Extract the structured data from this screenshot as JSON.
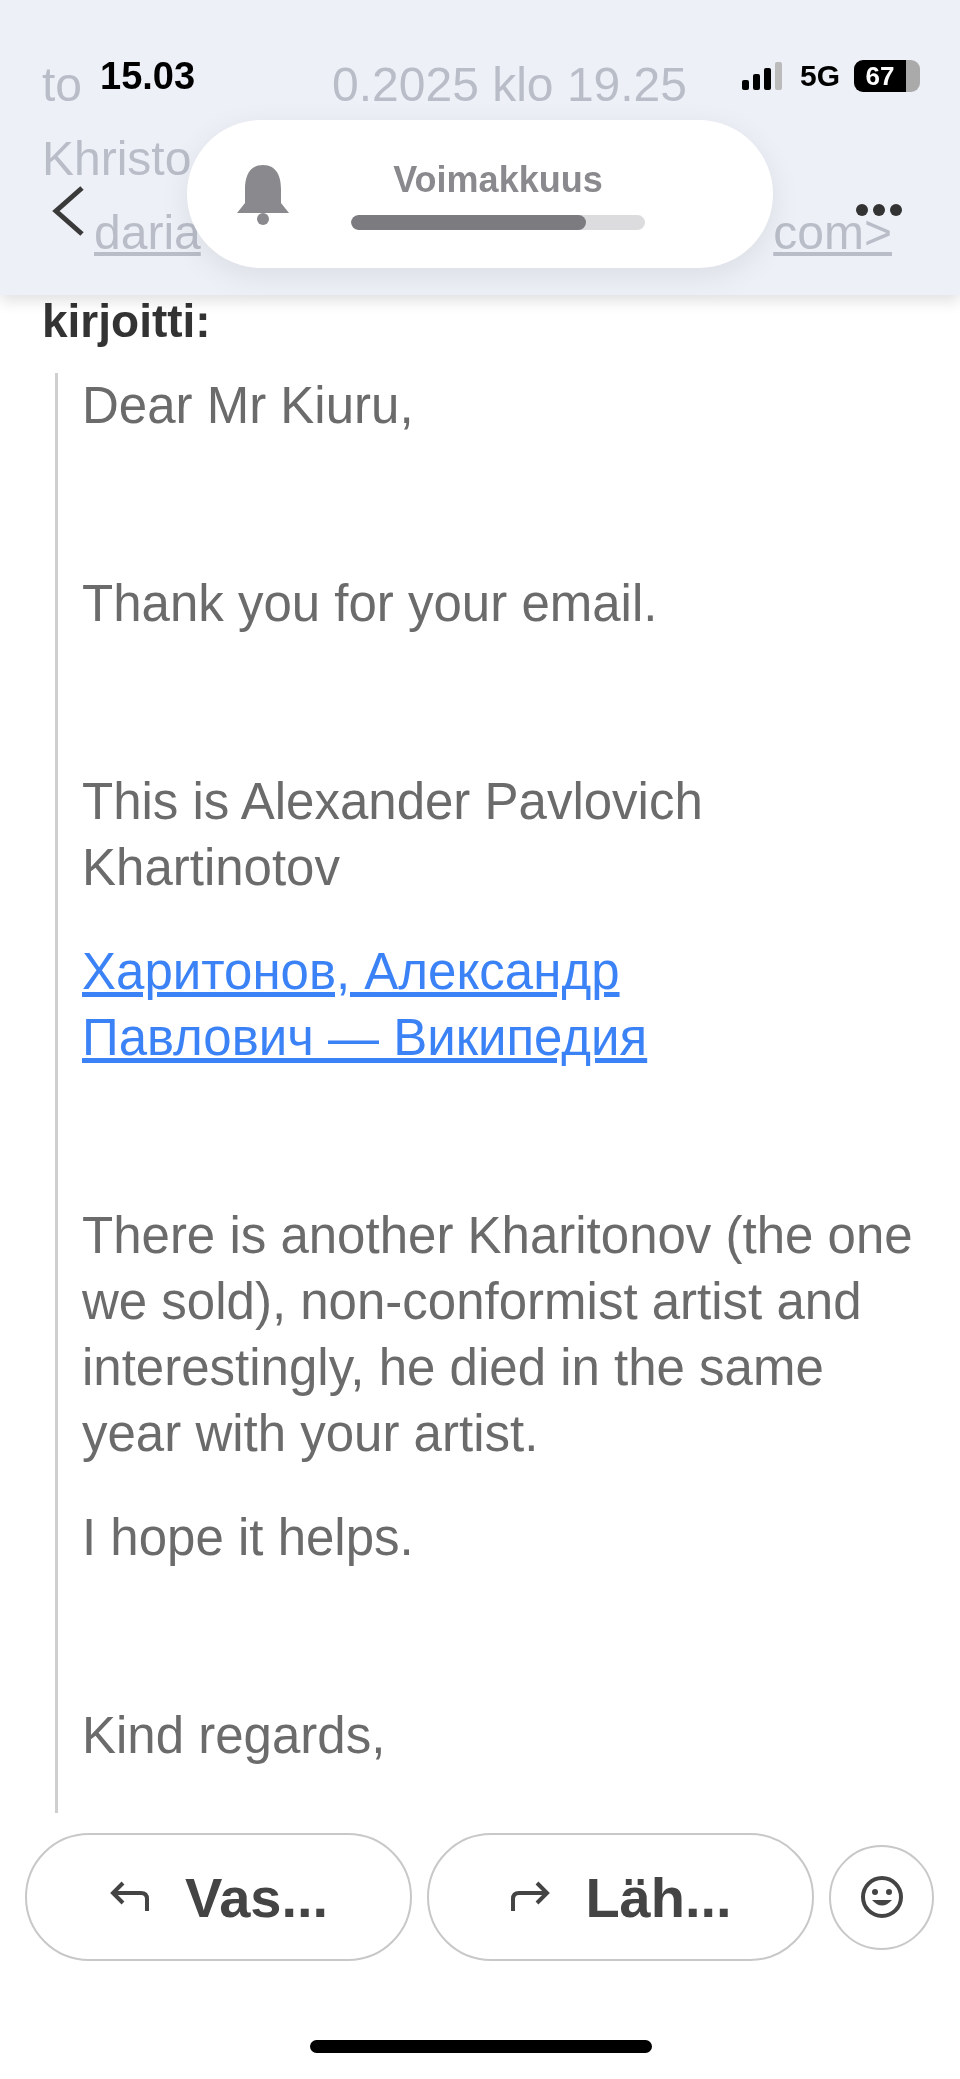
{
  "status_bar": {
    "time": "15.03",
    "network": "5G",
    "battery": "67"
  },
  "header_behind": {
    "fragments": [
      "to",
      "0.2025 klo 19.25",
      "Khristo",
      "daria",
      "com>"
    ]
  },
  "volume_hud": {
    "title": "Voimakkuus",
    "level": 0.8
  },
  "quote_intro": "kirjoitti:",
  "message": [
    {
      "kind": "text",
      "text": "Dear Mr Kiuru,"
    },
    {
      "kind": "text",
      "text": "Thank you for your email."
    },
    {
      "kind": "text",
      "text": "This is Alexander Pavlovich Khartinotov"
    },
    {
      "kind": "link",
      "text": "Харитонов, Александр Павлович — Википедия"
    },
    {
      "kind": "text",
      "text": "There is another Kharitonov (the one we sold), non-conformist artist and interestingly, he died in the same year with your artist."
    },
    {
      "kind": "text",
      "text": "I hope it helps."
    },
    {
      "kind": "text",
      "text": "Kind regards,"
    }
  ],
  "actions": [
    {
      "kind": "reply",
      "label": "Vas..."
    },
    {
      "kind": "forward",
      "label": "Läh..."
    }
  ]
}
